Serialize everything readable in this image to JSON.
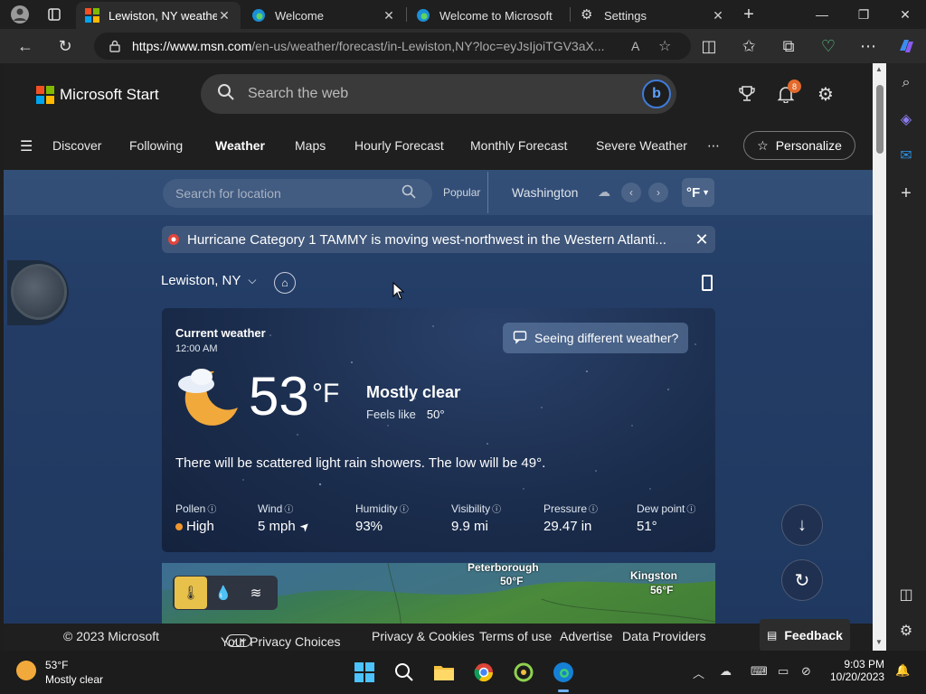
{
  "browser": {
    "tabs": [
      {
        "title": "Lewiston, NY weather",
        "active": true
      },
      {
        "title": "Welcome",
        "active": false
      },
      {
        "title": "Welcome to Microsoft",
        "active": false
      },
      {
        "title": "Settings",
        "active": false
      }
    ],
    "url_host": "https://www.msn.com",
    "url_path": "/en-us/weather/forecast/in-Lewiston,NY?loc=eyJsIjoiTGV3aX..."
  },
  "msn": {
    "brand": "Microsoft Start",
    "search_placeholder": "Search the web",
    "notification_count": "8",
    "nav": [
      "Discover",
      "Following",
      "Weather",
      "Maps",
      "Hourly Forecast",
      "Monthly Forecast",
      "Severe Weather"
    ],
    "nav_active": "Weather",
    "personalize_label": "Personalize"
  },
  "weather_bar": {
    "location_placeholder": "Search for location",
    "popular_label": "Popular",
    "popular_city": "Washington",
    "unit": "°F"
  },
  "alert": {
    "text": "Hurricane Category 1 TAMMY is moving west-northwest in the Western Atlanti..."
  },
  "location": {
    "name": "Lewiston, NY"
  },
  "current": {
    "title": "Current weather",
    "time": "12:00 AM",
    "seeing_different": "Seeing different weather?",
    "temperature": "53",
    "unit": "°F",
    "condition": "Mostly clear",
    "feels_like_label": "Feels like",
    "feels_like_value": "50°",
    "forecast_text": "There will be scattered light rain showers. The low will be 49°.",
    "metrics": [
      {
        "label": "Pollen",
        "value": "High"
      },
      {
        "label": "Wind",
        "value": "5 mph"
      },
      {
        "label": "Humidity",
        "value": "93%"
      },
      {
        "label": "Visibility",
        "value": "9.9 mi"
      },
      {
        "label": "Pressure",
        "value": "29.47 in"
      },
      {
        "label": "Dew point",
        "value": "51°"
      }
    ]
  },
  "map": {
    "cities": [
      {
        "name": "Peterborough",
        "temp": "50°F"
      },
      {
        "name": "Kingston",
        "temp": "56°F"
      }
    ]
  },
  "footer": {
    "copyright": "© 2023 Microsoft",
    "links": [
      "Your Privacy Choices",
      "Privacy & Cookies",
      "Terms of use",
      "Advertise",
      "Data Providers"
    ],
    "feedback": "Feedback"
  },
  "taskbar": {
    "weather_temp": "53°F",
    "weather_cond": "Mostly clear",
    "time": "9:03 PM",
    "date": "10/20/2023"
  },
  "colors": {
    "accent_blue": "#3f7bd9",
    "pollen_high": "#f0962e",
    "badge": "#e36a2d"
  }
}
